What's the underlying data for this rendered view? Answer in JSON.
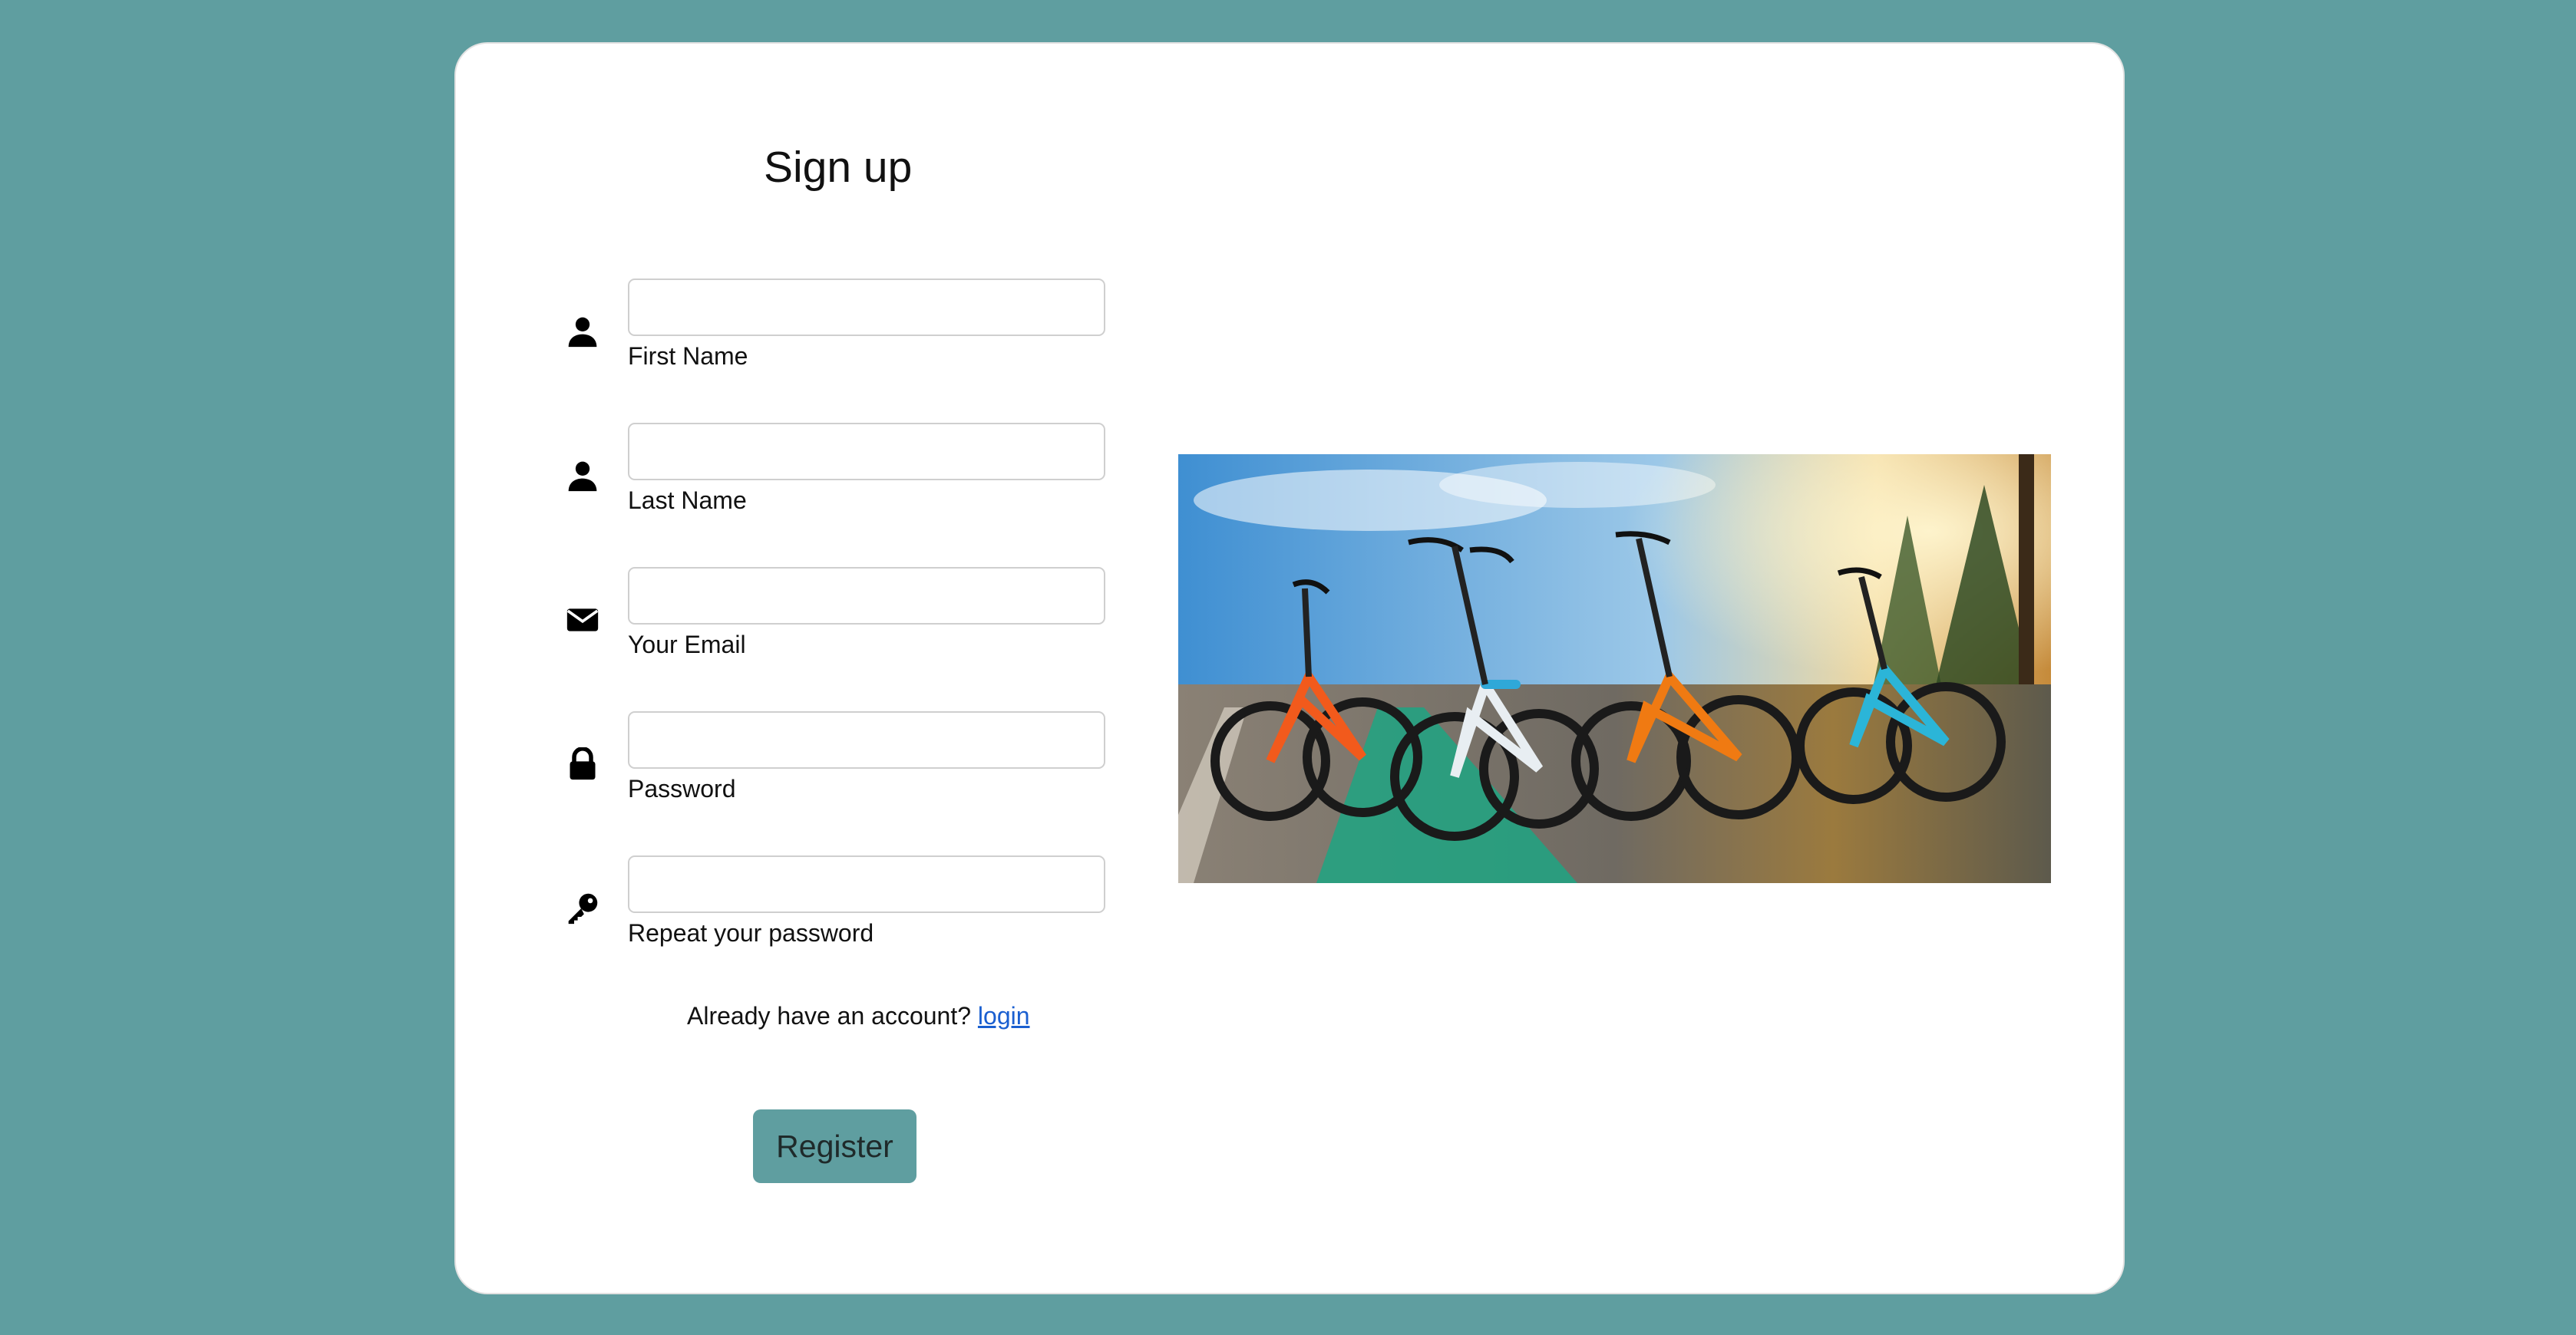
{
  "title": "Sign up",
  "fields": {
    "first_name": {
      "label": "First Name",
      "value": "",
      "placeholder": ""
    },
    "last_name": {
      "label": "Last Name",
      "value": "",
      "placeholder": ""
    },
    "email": {
      "label": "Your Email",
      "value": "",
      "placeholder": ""
    },
    "password": {
      "label": "Password",
      "value": "",
      "placeholder": ""
    },
    "repeat_password": {
      "label": "Repeat your password",
      "value": "",
      "placeholder": ""
    }
  },
  "login_prompt": {
    "text": "Already have an account? ",
    "link_label": "login"
  },
  "register_button": "Register",
  "icons": {
    "first_name": "user-icon",
    "last_name": "user-icon",
    "email": "envelope-icon",
    "password": "lock-icon",
    "repeat_password": "key-icon"
  },
  "colors": {
    "background": "#5f9ea0",
    "card": "#ffffff",
    "button": "#5f9ea0",
    "link": "#1a5fd0"
  }
}
